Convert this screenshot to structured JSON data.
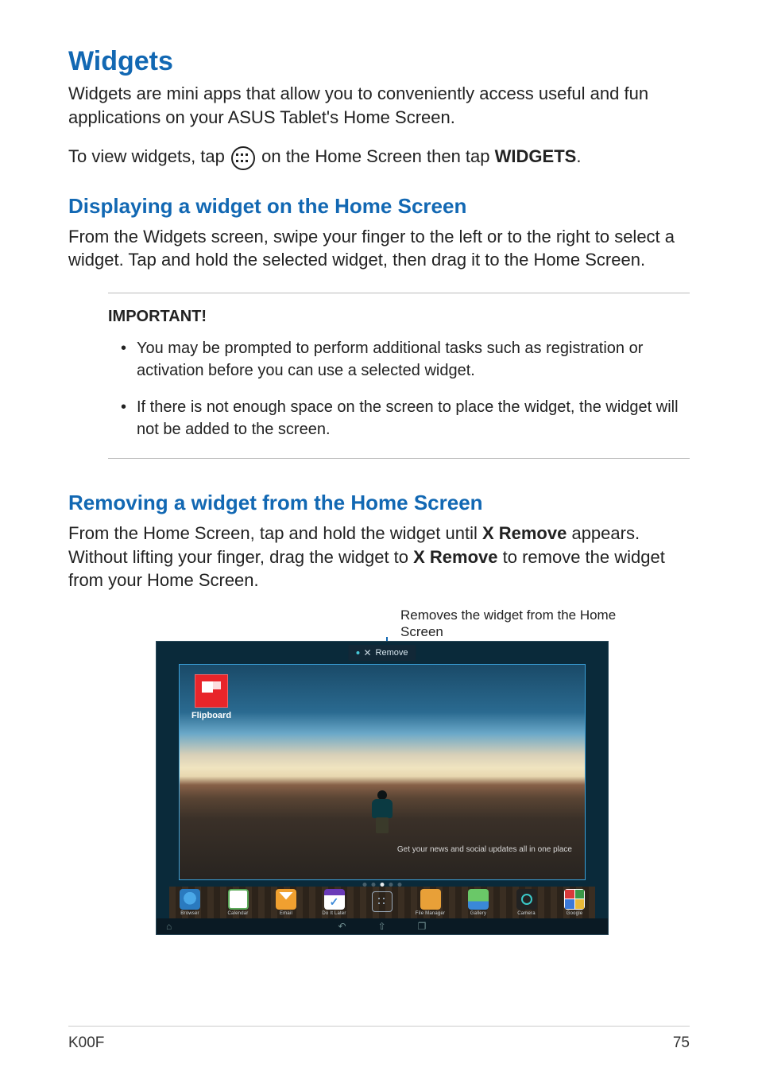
{
  "title": "Widgets",
  "intro": "Widgets are mini apps that allow you to conveniently access useful and fun applications on your ASUS Tablet's Home Screen.",
  "view_line_pre": "To view widgets, tap ",
  "view_line_post_1": " on the Home Screen then tap ",
  "view_line_bold": "WIDGETS",
  "view_line_end": ".",
  "section1_title": "Displaying a widget on the Home Screen",
  "section1_body": "From the Widgets screen, swipe your finger to the left or to the right to select a widget. Tap and hold the selected widget, then drag it to the Home Screen.",
  "important_label": "IMPORTANT!",
  "important_items": [
    "You may be prompted to perform additional tasks such as registration or activation before you can use a selected widget.",
    "If there is not enough space on the screen to place the widget, the widget will not be added to the screen."
  ],
  "section2_title": "Removing a widget from the Home Screen",
  "section2_body_1": "From the Home Screen, tap and hold the widget until ",
  "section2_bold_1": "X Remove",
  "section2_body_2": " appears. Without lifting your finger, drag the widget to ",
  "section2_bold_2": "X Remove",
  "section2_body_3": " to remove the widget from your Home Screen.",
  "callout": "Removes the widget from the Home Screen",
  "tablet": {
    "remove_label": "Remove",
    "flipboard_label": "Flipboard",
    "tagline": "Get your news and social updates all in one place",
    "dock": [
      "Browser",
      "Calendar",
      "Email",
      "Do It Later",
      "",
      "File Manager",
      "Gallery",
      "Camera",
      "Google"
    ]
  },
  "footer_left": "K00F",
  "footer_right": "75"
}
